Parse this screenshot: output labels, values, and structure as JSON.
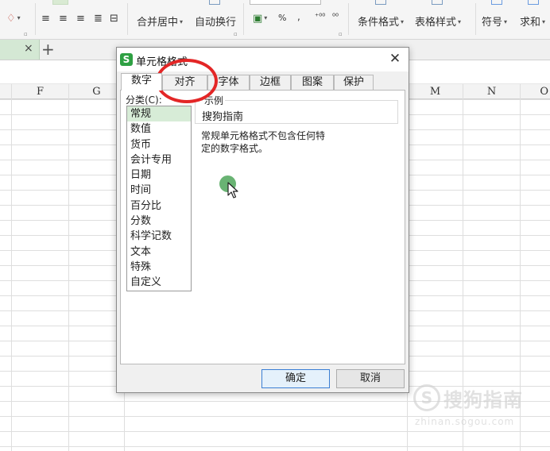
{
  "ribbon": {
    "merge_center": "合并居中",
    "auto_wrap": "自动换行",
    "percent": "%",
    "comma": ",",
    "inc_decimal": "⁺⁰⁰",
    "dec_decimal": "⁰⁰",
    "conditional_format": "条件格式",
    "table_style": "表格样式",
    "symbol": "符号",
    "sum": "求和"
  },
  "tabbar": {
    "close": "×",
    "add": "+"
  },
  "columns": [
    "F",
    "G",
    "M",
    "N",
    "O"
  ],
  "dialog": {
    "app_icon_letter": "S",
    "title": "单元格格式",
    "close": "✕",
    "tabs": [
      {
        "label": "数字"
      },
      {
        "label": "对齐"
      },
      {
        "label": "字体"
      },
      {
        "label": "边框"
      },
      {
        "label": "图案"
      },
      {
        "label": "保护"
      }
    ],
    "category_label": "分类(C):",
    "categories": [
      "常规",
      "数值",
      "货币",
      "会计专用",
      "日期",
      "时间",
      "百分比",
      "分数",
      "科学记数",
      "文本",
      "特殊",
      "自定义"
    ],
    "selected_category": "常规",
    "sample_label": "示例",
    "sample_value": "搜狗指南",
    "description": "常规单元格格式不包含任何特定的数字格式。",
    "ok": "确定",
    "cancel": "取消"
  },
  "watermark": {
    "logo": "S",
    "main": "搜狗指南",
    "sub": "zhinan.sogou.com"
  },
  "colors": {
    "accent_green": "#2ea043",
    "selection_green": "#d7ecd7",
    "annotation_red": "#e32626",
    "click_dot_green": "#4fa65a"
  }
}
